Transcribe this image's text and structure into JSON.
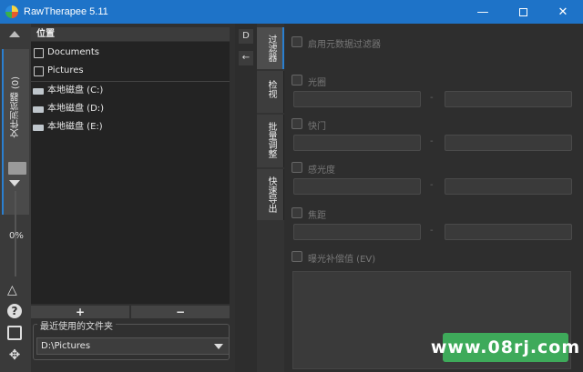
{
  "window": {
    "title": "RawTherapee 5.11",
    "minimize_icon": "minimize-icon",
    "maximize_icon": "maximize-icon",
    "close_icon": "close-icon",
    "accent": "#1e73c8"
  },
  "left_bar": {
    "tab_label": "文件浏览器 (0)",
    "progress": "0%"
  },
  "browser": {
    "places_header": "位置",
    "places": [
      {
        "label": "Documents",
        "icon": "document-icon"
      },
      {
        "label": "Pictures",
        "icon": "picture-icon"
      }
    ],
    "drives": [
      {
        "label": "本地磁盘 (C:)"
      },
      {
        "label": "本地磁盘 (D:)"
      },
      {
        "label": "本地磁盘 (E:)"
      }
    ],
    "add_label": "+",
    "remove_label": "−",
    "recent": {
      "label": "最近使用的文件夹",
      "value": "D:\\Pictures"
    }
  },
  "mid": {
    "tab_label": "D"
  },
  "right_tabs": [
    {
      "label": "过滤器",
      "active": true
    },
    {
      "label": "检视",
      "active": false
    },
    {
      "label": "批量调整",
      "active": false
    },
    {
      "label": "快速导出",
      "active": false
    }
  ],
  "filter": {
    "metadata_filter": "启用元数据过滤器",
    "aperture": "光圈",
    "shutter": "快门",
    "iso": "感光度",
    "focal": "焦距",
    "exposure_comp": "曝光补偿值 (EV)",
    "dash": "-"
  },
  "watermark": "www.08rj.com"
}
